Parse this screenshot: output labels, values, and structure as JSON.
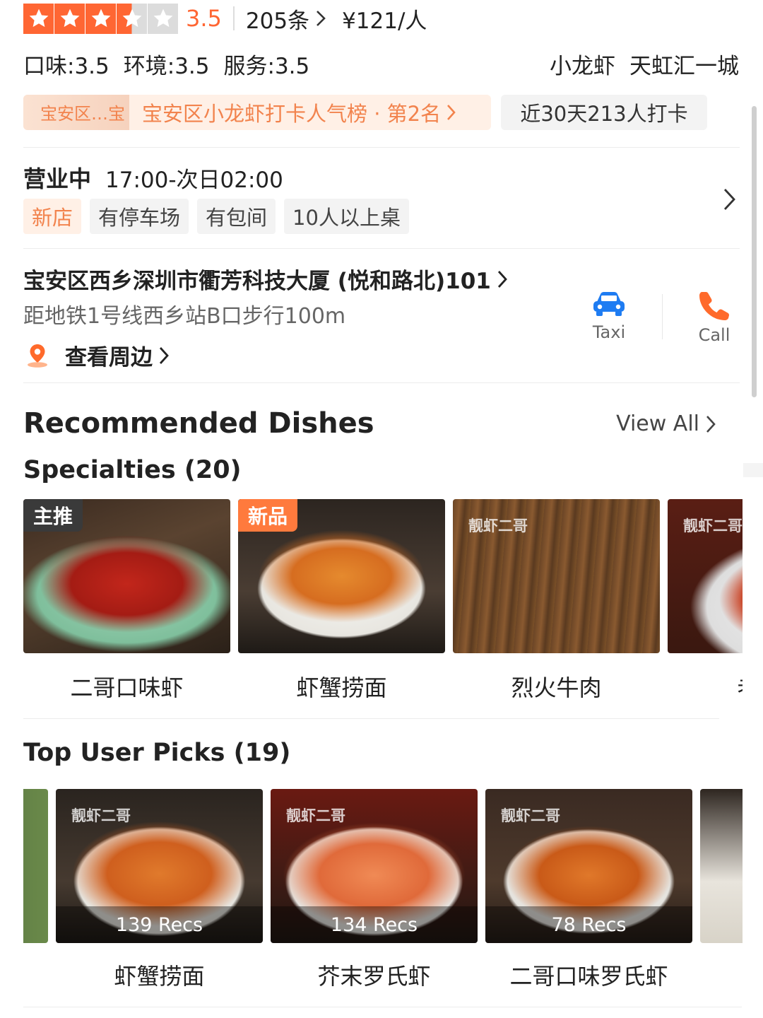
{
  "header": {
    "rating": "3.5",
    "rating_stars": 3.5,
    "review_count": "205条",
    "price": "¥121/人",
    "scores": {
      "taste": "口味:3.5",
      "environment": "环境:3.5",
      "service": "服务:3.5"
    },
    "category": "小龙虾",
    "district": "天虹汇一城"
  },
  "ranking": {
    "badge": "宝安区…宝",
    "text": "宝安区小龙虾打卡人气榜 · 第2名",
    "checkins": "近30天213人打卡"
  },
  "hours": {
    "status": "营业中",
    "time": "17:00-次日02:00",
    "facilities": [
      "新店",
      "有停车场",
      "有包间",
      "10人以上桌"
    ]
  },
  "location": {
    "address": "宝安区西乡深圳市衢芳科技大厦 (悦和路北)101",
    "metro": "距地铁1号线西乡站B口步行100m",
    "nearby": "查看周边",
    "taxi_label": "Taxi",
    "call_label": "Call"
  },
  "recommended": {
    "title": "Recommended Dishes",
    "view_all": "View All",
    "specialties_title": "Specialties (20)",
    "specialties": [
      {
        "name": "二哥口味虾",
        "badge": "主推",
        "image": "spicy-crayfish-photo"
      },
      {
        "name": "虾蟹捞面",
        "badge": "新品",
        "image": "seafood-noodles-photo"
      },
      {
        "name": "烈火牛肉",
        "badge": "",
        "image": "beef-skewers-photo"
      },
      {
        "name": "老长沙",
        "badge": "",
        "image": "crayfish-bowl-photo"
      }
    ],
    "top_picks_title": "Top User Picks (19)",
    "top_picks": [
      {
        "name": "虾蟹捞面",
        "recs": "139 Recs",
        "image": "seafood-noodles-photo"
      },
      {
        "name": "芥末罗氏虾",
        "recs": "134 Recs",
        "image": "wasabi-prawn-photo"
      },
      {
        "name": "二哥口味罗氏虾",
        "recs": "78 Recs",
        "image": "spicy-prawn-photo"
      }
    ],
    "brand_watermark": "靓虾二哥"
  },
  "colors": {
    "accent": "#ff6633",
    "ranking_text": "#f2834d",
    "tag_bg": "#f3f3f3",
    "taxi_blue": "#1e7cf2",
    "call_orange": "#ff6a2b"
  }
}
